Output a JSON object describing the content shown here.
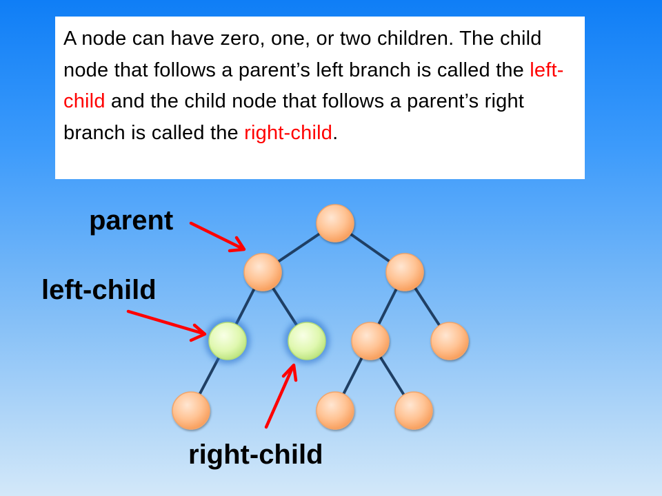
{
  "description": {
    "part1": "A node can have zero, one, or two children. The child node that follows a parent’s left branch is called the ",
    "term_left": "left-child",
    "part2": " and the child node that follows a parent’s right branch is called the ",
    "term_right": "right-child",
    "part3": "."
  },
  "labels": {
    "parent": "parent",
    "left_child": "left-child",
    "right_child": "right-child"
  },
  "colors": {
    "node_orange": "#ffb27a",
    "node_green": "#d6f59a",
    "edge": "#1f3f64",
    "arrow": "#ff0000",
    "term_highlight": "#ff0000"
  }
}
